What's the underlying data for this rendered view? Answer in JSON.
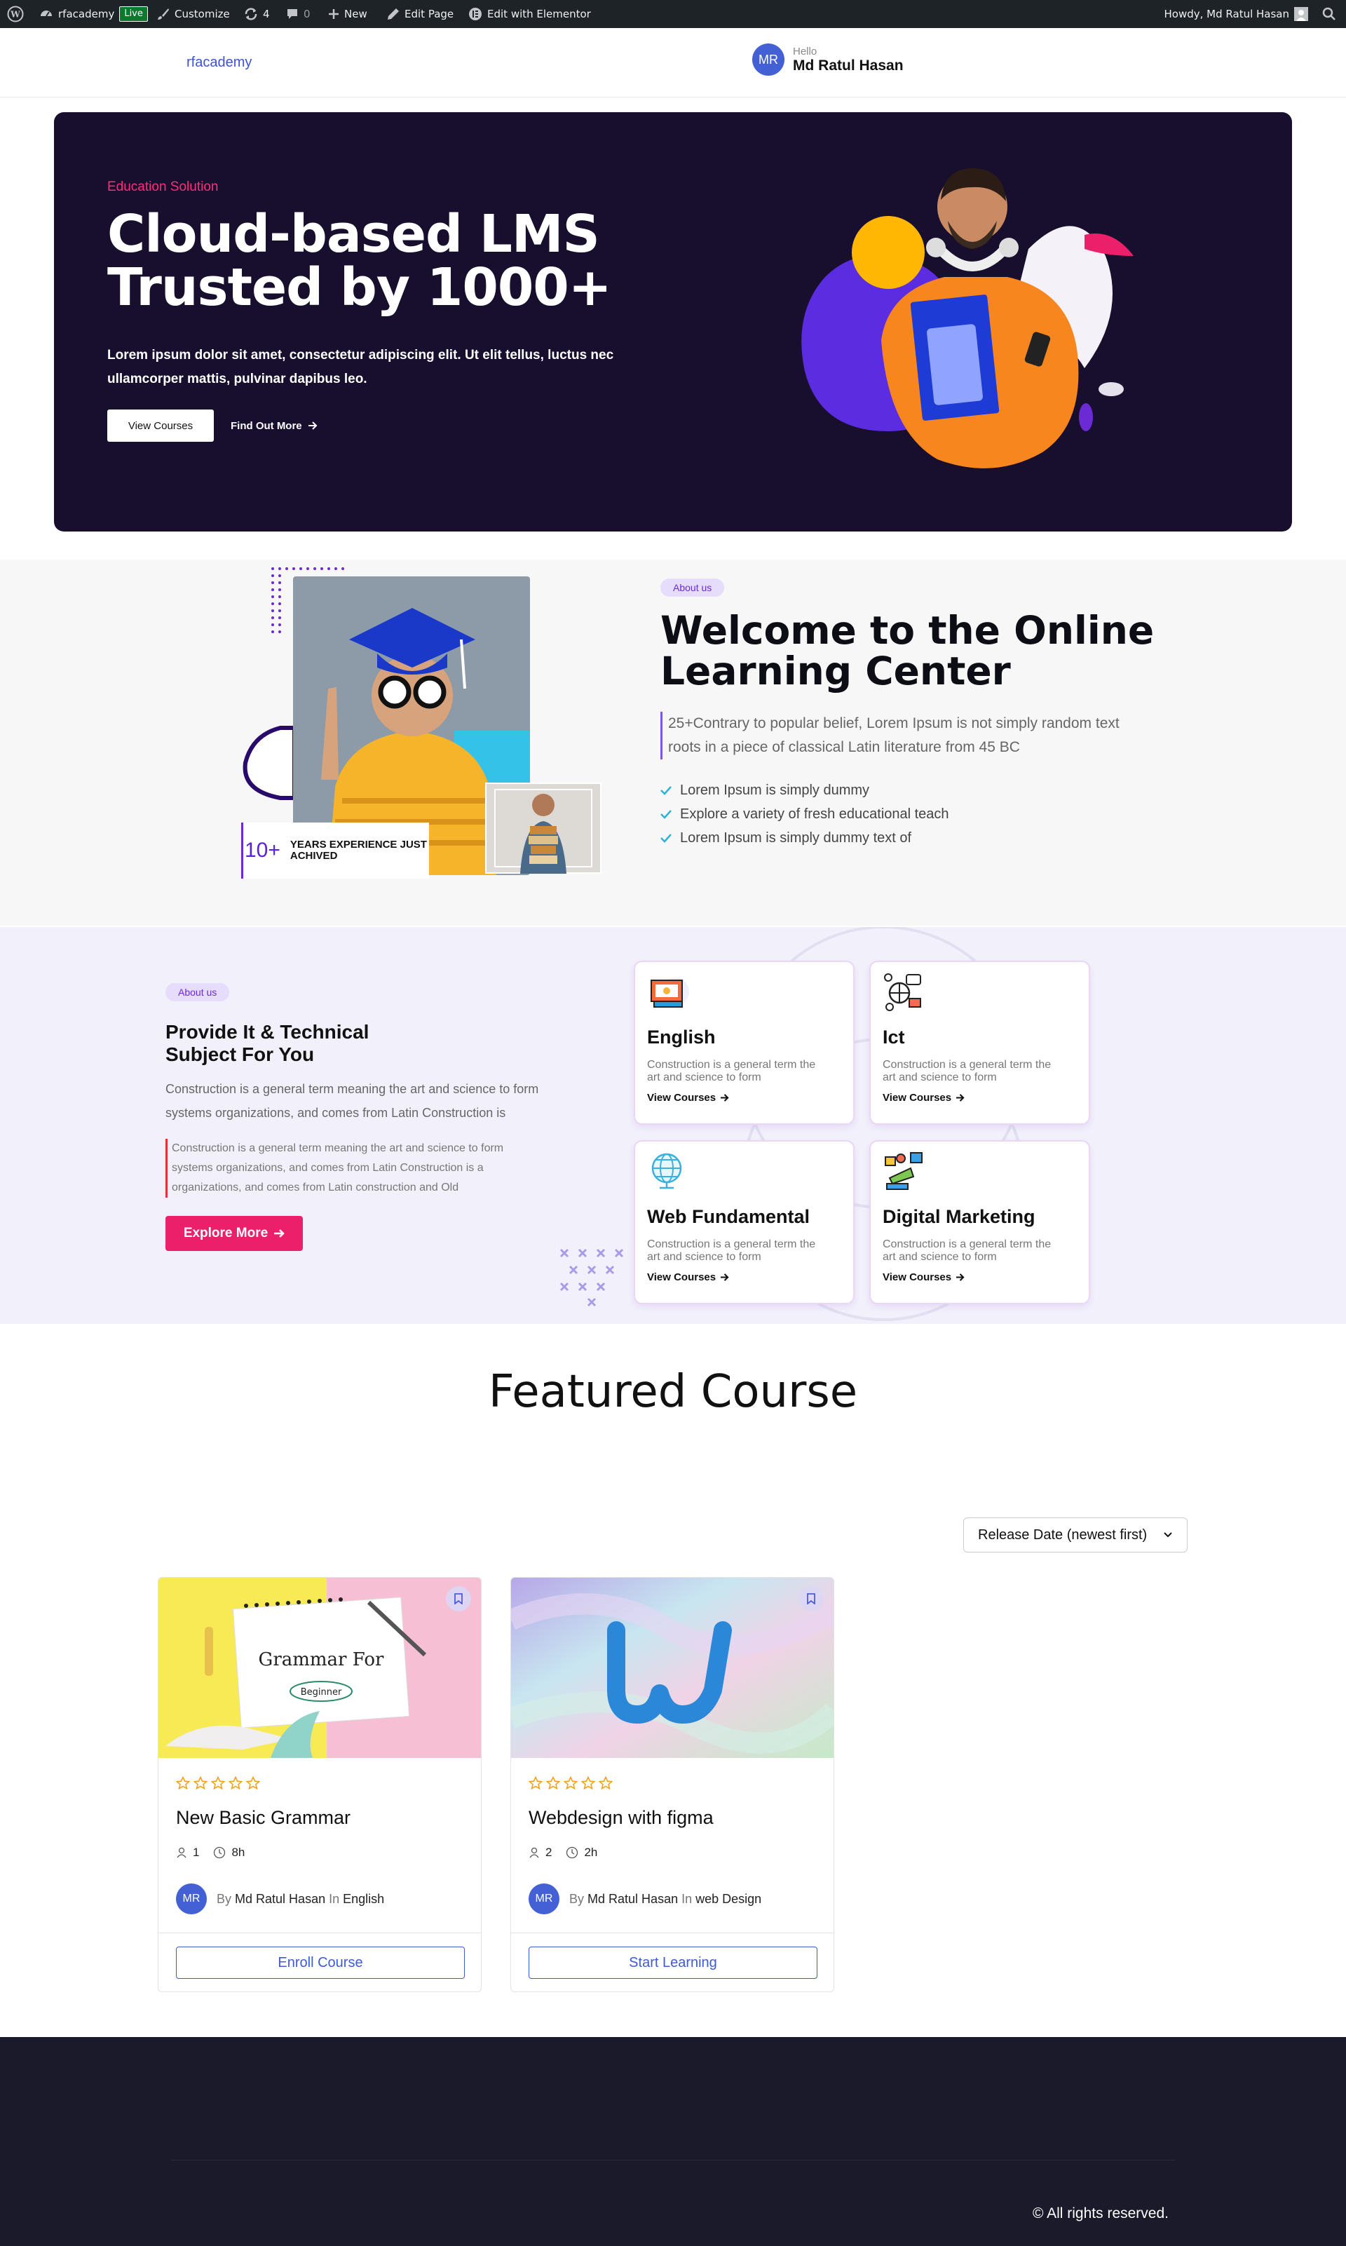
{
  "admin_bar": {
    "site_name": "rfacademy",
    "live_badge": "Live",
    "customize": "Customize",
    "updates_count": "4",
    "comments_count": "0",
    "new_label": "New",
    "edit_page": "Edit Page",
    "edit_elementor": "Edit with Elementor",
    "howdy": "Howdy, Md Ratul Hasan"
  },
  "header": {
    "brand": "rfacademy",
    "avatar_initials": "MR",
    "hello": "Hello",
    "user_name": "Md Ratul Hasan"
  },
  "hero": {
    "eyebrow": "Education Solution",
    "title_line1": "Cloud-based LMS",
    "title_line2": "Trusted by 1000+",
    "description": "Lorem ipsum dolor sit amet, consectetur adipiscing elit. Ut elit tellus, luctus nec ullamcorper mattis, pulvinar dapibus leo.",
    "primary_button": "View Courses",
    "secondary_link": "Find Out More"
  },
  "about": {
    "badge": "About us",
    "title": "Welcome to the Online Learning Center",
    "quote": "25+Contrary to popular belief, Lorem Ipsum is not simply random text roots in a piece of classical Latin literature from 45 BC",
    "checklist": [
      "Lorem Ipsum is simply dummy",
      "Explore a variety of fresh educational teach",
      "Lorem Ipsum is simply dummy text of"
    ],
    "stat_number": "10+",
    "stat_text": "YEARS EXPERIENCE JUST ACHIVED"
  },
  "subjects": {
    "badge": "About us",
    "title": "Provide It & Technical Subject For You",
    "paragraph": "Construction is a general term meaning the art and science to form systems organizations, and comes from Latin Construction is",
    "quote": "Construction is a general term meaning the art and science to form systems organizations, and comes from Latin Construction is a organizations, and comes from Latin construction and Old",
    "button": "Explore More",
    "cards": [
      {
        "title": "English",
        "desc": "Construction is a general term the art and science to form",
        "link": "View Courses",
        "icon": "certificate-icon"
      },
      {
        "title": "Ict",
        "desc": "Construction is a general term the art and science to form",
        "link": "View Courses",
        "icon": "network-icon"
      },
      {
        "title": "Web Fundamental",
        "desc": "Construction is a general term the art and science to form",
        "link": "View Courses",
        "icon": "globe-icon"
      },
      {
        "title": "Digital Marketing",
        "desc": "Construction is a general term the art and science to form",
        "link": "View Courses",
        "icon": "marketing-icon"
      }
    ]
  },
  "featured": {
    "title": "Featured Course",
    "sort_label": "Release Date (newest first)",
    "courses": [
      {
        "title": "New Basic Grammar",
        "students": "1",
        "duration": "8h",
        "author_initials": "MR",
        "by": "By",
        "author": "Md Ratul Hasan",
        "in": "In",
        "category": "English",
        "button": "Enroll Course",
        "thumb_title": "Grammar For",
        "thumb_sub": "Beginner"
      },
      {
        "title": "Webdesign with figma",
        "students": "2",
        "duration": "2h",
        "author_initials": "MR",
        "by": "By",
        "author": "Md Ratul Hasan",
        "in": "In",
        "category": "web Design",
        "button": "Start Learning"
      }
    ]
  },
  "footer": {
    "copyright": "© All rights reserved."
  },
  "colors": {
    "admin_bar": "#1d2327",
    "hero_bg": "#180f2e",
    "accent_pink": "#ec1f6b",
    "accent_purple": "#6a2bd4",
    "brand_blue": "#3f51d6",
    "footer_bg": "#1b1a2b"
  }
}
